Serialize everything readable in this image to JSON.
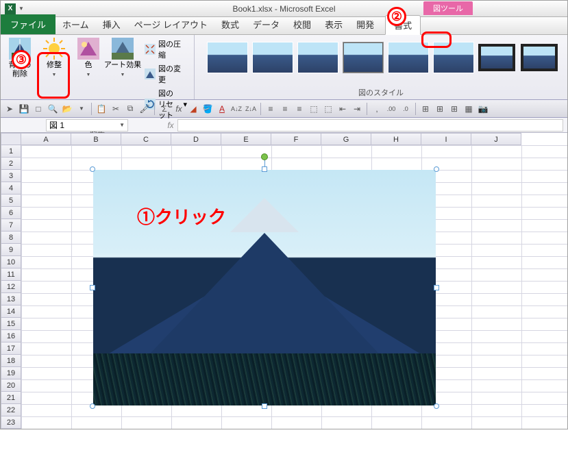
{
  "titlebar": {
    "title": "Book1.xlsx - Microsoft Excel"
  },
  "tool_context": {
    "label": "図ツール"
  },
  "tabs": {
    "file": "ファイル",
    "items": [
      "ホーム",
      "挿入",
      "ページ レイアウト",
      "数式",
      "データ",
      "校閲",
      "表示",
      "開発"
    ],
    "format": "書式"
  },
  "ribbon": {
    "remove_bg": "背景の\n削除",
    "corrections": "修整",
    "color": "色",
    "artistic": "アート効果",
    "compress": "図の圧縮",
    "change": "図の変更",
    "reset": "図のリセット",
    "adjust_label": "調整",
    "styles_label": "図のスタイル"
  },
  "namebox": {
    "value": "図 1"
  },
  "formulabar": {
    "fx": "fx"
  },
  "columns": [
    "A",
    "B",
    "C",
    "D",
    "E",
    "F",
    "G",
    "H",
    "I",
    "J"
  ],
  "rows": [
    "1",
    "2",
    "3",
    "4",
    "5",
    "6",
    "7",
    "8",
    "9",
    "10",
    "11",
    "12",
    "13",
    "14",
    "15",
    "16",
    "17",
    "18",
    "19",
    "20",
    "21",
    "22",
    "23"
  ],
  "annotations": {
    "n1": "①",
    "click": "クリック",
    "n2": "②",
    "n3": "③"
  }
}
